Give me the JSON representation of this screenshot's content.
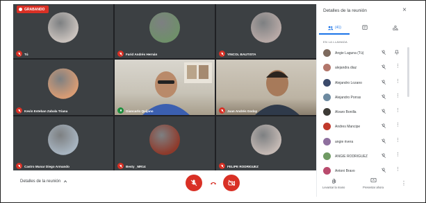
{
  "recording_badge": "GRABANDO",
  "tiles": [
    {
      "name": "Tú",
      "kind": "avatar",
      "color": "#c9c2bd"
    },
    {
      "name": "Farid Andrés Hernán",
      "kind": "avatar",
      "color": "#6f8f6a"
    },
    {
      "name": "YINCOL BAUTISTA",
      "kind": "avatar",
      "color": "#b7a9a6"
    },
    {
      "name": "Kevin Esteban Zabala Triana",
      "kind": "avatar",
      "color": "#d89c74"
    },
    {
      "name": "Giancarlo Quijano",
      "kind": "video"
    },
    {
      "name": "Juan Andrés Goday",
      "kind": "video"
    },
    {
      "name": "Castro Munar Diego Armando",
      "kind": "avatar",
      "color": "#a7b4c0"
    },
    {
      "name": "Besty _MR14",
      "kind": "avatar",
      "color": "#8e3a2b"
    },
    {
      "name": "FELIPE RODRIGUEZ",
      "kind": "avatar",
      "color": "#c4b9b4"
    }
  ],
  "bottom": {
    "details_label": "Detalles de la reunión",
    "mic_color": "#d93025",
    "hangup_color": "#d93025",
    "cam_color": "#d93025"
  },
  "panel": {
    "title": "Detalles de la reunión",
    "people_tab_count": "(41)",
    "section_label": "EN LA LLAMADA",
    "participants": [
      {
        "name": "Angie Laguna (Tú)",
        "color": "#7d6a5e"
      },
      {
        "name": "alejandra diaz",
        "color": "#b2766b"
      },
      {
        "name": "Alejandro Lozano",
        "color": "#3b4a6b"
      },
      {
        "name": "Alejandro Porras",
        "color": "#6d8aa0"
      },
      {
        "name": "Alvaro Bonilla",
        "color": "#3d3a36"
      },
      {
        "name": "Andres Mancipe",
        "color": "#c0392b"
      },
      {
        "name": "angie rivera",
        "color": "#8e6f9e"
      },
      {
        "name": "ANGIE RODRIGUEZ",
        "color": "#6f9a63"
      },
      {
        "name": "Antoni Bravo",
        "color": "#b94b6d"
      }
    ],
    "raise_hand_label": "Levantar la mano",
    "present_label": "Presentar ahora",
    "accent_color": "#1a73e8"
  }
}
